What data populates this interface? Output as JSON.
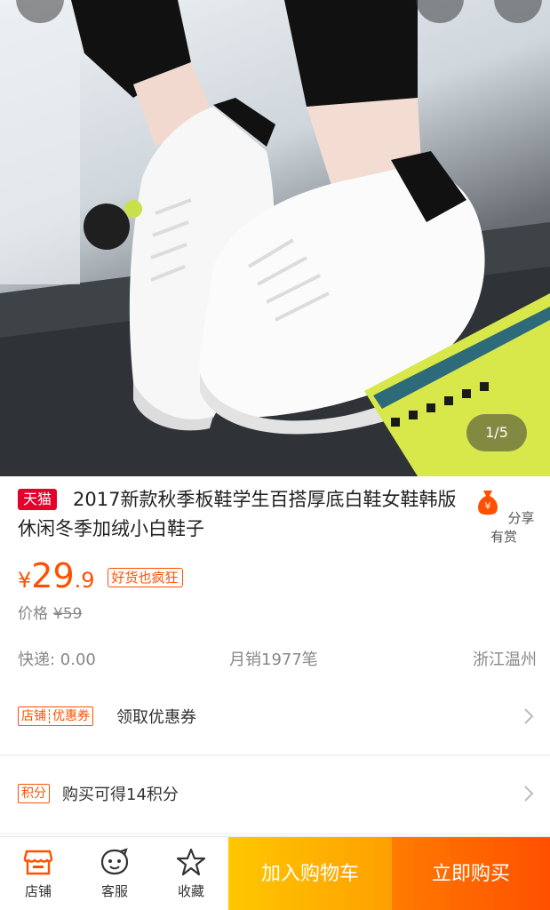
{
  "gallery": {
    "counter": "1/5"
  },
  "product": {
    "badge": "天猫",
    "title": "2017新款秋季板鞋学生百搭厚底白鞋女鞋韩版休闲冬季加绒小白鞋子",
    "share_label": "分享有赏"
  },
  "price": {
    "symbol": "¥",
    "integer": "29",
    "decimal": ".9",
    "tag": "好货也疯狂",
    "orig_label": "价格",
    "orig_value": "¥59"
  },
  "info": {
    "shipping": "快递: 0.00",
    "monthly_sales": "月销1977笔",
    "location": "浙江温州"
  },
  "coupon": {
    "tag_a": "店铺",
    "tag_b": "优惠券",
    "label": "领取优惠券"
  },
  "points": {
    "tag": "积分",
    "label": "购买可得14积分"
  },
  "bottom_bar": {
    "store": "店铺",
    "service": "客服",
    "favorite": "收藏",
    "add_to_cart": "加入购物车",
    "buy_now": "立即购买"
  },
  "colors": {
    "accent": "#ff5000",
    "tmall_red": "#e5002b",
    "cart_yellow": "#ffb300",
    "buy_orange": "#ff5a00"
  }
}
